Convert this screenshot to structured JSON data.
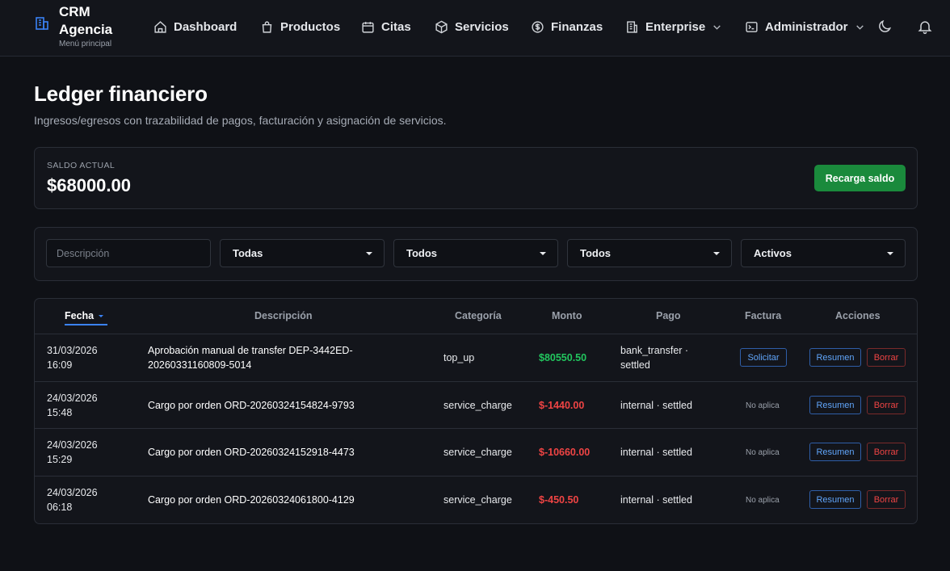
{
  "brand": {
    "title": "CRM Agencia",
    "subtitle": "Menú principal"
  },
  "nav": [
    {
      "label": "Dashboard",
      "icon": "home-icon"
    },
    {
      "label": "Productos",
      "icon": "shopping-bag-icon"
    },
    {
      "label": "Citas",
      "icon": "calendar-icon"
    },
    {
      "label": "Servicios",
      "icon": "box-icon"
    },
    {
      "label": "Finanzas",
      "icon": "dollar-icon"
    },
    {
      "label": "Enterprise",
      "icon": "building-icon"
    },
    {
      "label": "Administrador",
      "icon": "terminal-icon"
    }
  ],
  "header": {
    "title": "Ledger financiero",
    "subtitle": "Ingresos/egresos con trazabilidad de pagos, facturación y asignación de servicios."
  },
  "balance": {
    "label": "SALDO ACTUAL",
    "value": "$68000.00",
    "button": "Recarga saldo"
  },
  "filters": {
    "description_placeholder": "Descripción",
    "selects": [
      "Todas",
      "Todos",
      "Todos",
      "Activos"
    ]
  },
  "table": {
    "headers": [
      "Fecha",
      "Descripción",
      "Categoría",
      "Monto",
      "Pago",
      "Factura",
      "Acciones"
    ],
    "rows": [
      {
        "date_line1": "31/03/2026",
        "date_line2": "16:09",
        "desc_line1": "Aprobación manual de transfer DEP-3442ED-",
        "desc_line2": "20260331160809-5014",
        "category": "top_up",
        "amount": "$80550.50",
        "amount_sign": "pos",
        "pay_line1": "bank_transfer ·",
        "pay_line2": "settled",
        "invoice": "Solicitar",
        "resume": "Resumen",
        "delete": "Borrar"
      },
      {
        "date_line1": "24/03/2026",
        "date_line2": "15:48",
        "desc_line1": "Cargo por orden ORD-20260324154824-9793",
        "desc_line2": "",
        "category": "service_charge",
        "amount": "$-1440.00",
        "amount_sign": "neg",
        "pay_line1": "internal · settled",
        "pay_line2": "",
        "invoice": "No aplica",
        "resume": "Resumen",
        "delete": "Borrar"
      },
      {
        "date_line1": "24/03/2026",
        "date_line2": "15:29",
        "desc_line1": "Cargo por orden ORD-20260324152918-4473",
        "desc_line2": "",
        "category": "service_charge",
        "amount": "$-10660.00",
        "amount_sign": "neg",
        "pay_line1": "internal · settled",
        "pay_line2": "",
        "invoice": "No aplica",
        "resume": "Resumen",
        "delete": "Borrar"
      },
      {
        "date_line1": "24/03/2026",
        "date_line2": "06:18",
        "desc_line1": "Cargo por orden ORD-20260324061800-4129",
        "desc_line2": "",
        "category": "service_charge",
        "amount": "$-450.50",
        "amount_sign": "neg",
        "pay_line1": "internal · settled",
        "pay_line2": "",
        "invoice": "No aplica",
        "resume": "Resumen",
        "delete": "Borrar"
      }
    ]
  },
  "colors": {
    "accent": "#3b82f6",
    "success": "#1a8a3c",
    "positive": "#22c55e",
    "negative": "#ef4444",
    "background": "#0f1116"
  }
}
